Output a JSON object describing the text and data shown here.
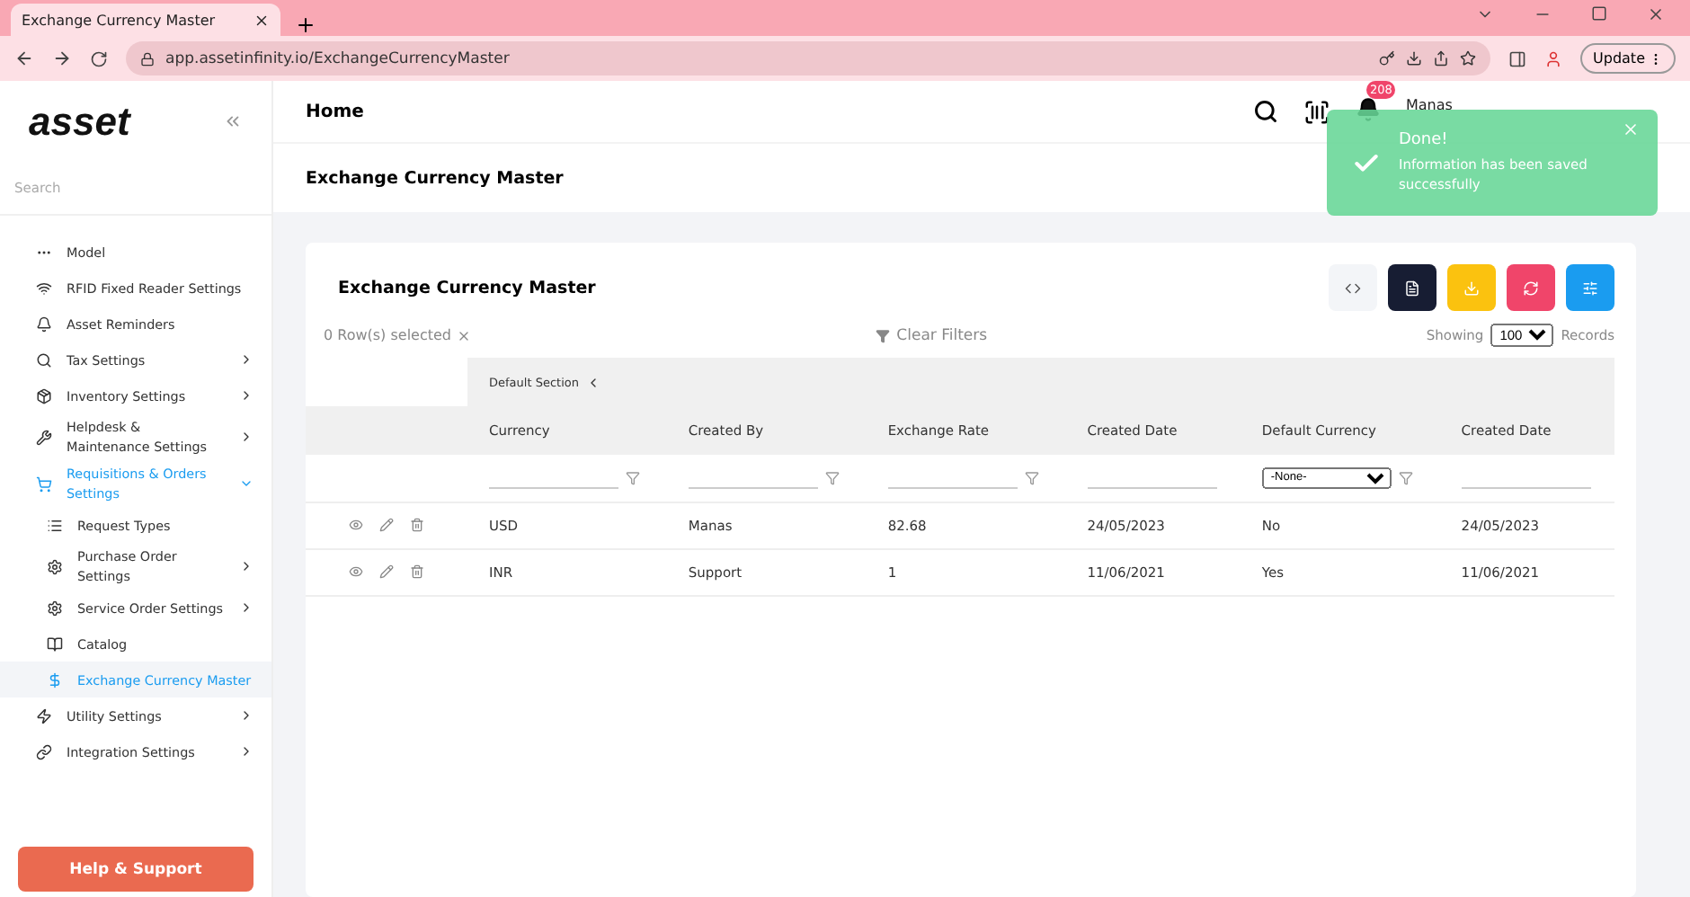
{
  "browser": {
    "tab_title": "Exchange Currency Master",
    "url": "app.assetinfinity.io/ExchangeCurrencyMaster",
    "update_label": "Update"
  },
  "sidebar": {
    "logo": "asset",
    "search_placeholder": "Search",
    "items": [
      {
        "label": "Model",
        "selected": false,
        "has_children": false
      },
      {
        "label": "RFID Fixed Reader Settings",
        "selected": false,
        "has_children": false
      },
      {
        "label": "Asset Reminders",
        "selected": false,
        "has_children": false
      },
      {
        "label": "Tax Settings",
        "selected": false,
        "has_children": true
      },
      {
        "label": "Inventory Settings",
        "selected": false,
        "has_children": true
      },
      {
        "label": "Helpdesk & Maintenance Settings",
        "selected": false,
        "has_children": true
      },
      {
        "label": "Requisitions & Orders Settings",
        "selected": true,
        "has_children": true,
        "expanded": true,
        "children": [
          {
            "label": "Request Types",
            "selected": false,
            "has_children": false
          },
          {
            "label": "Purchase Order Settings",
            "selected": false,
            "has_children": true
          },
          {
            "label": "Service Order Settings",
            "selected": false,
            "has_children": true
          },
          {
            "label": "Catalog",
            "selected": false,
            "has_children": false
          },
          {
            "label": "Exchange Currency Master",
            "selected": true,
            "has_children": false
          }
        ]
      },
      {
        "label": "Utility Settings",
        "selected": false,
        "has_children": true
      },
      {
        "label": "Integration Settings",
        "selected": false,
        "has_children": true
      }
    ],
    "help_button": "Help & Support"
  },
  "header": {
    "title": "Home",
    "notification_count": "208",
    "user_name": "Manas"
  },
  "page_title": "Exchange Currency Master",
  "toast": {
    "title": "Done!",
    "message": "Information has been saved successfully"
  },
  "card": {
    "title": "Exchange Currency Master",
    "rows_selected": "0 Row(s) selected",
    "clear_filters": "Clear Filters",
    "showing_label": "Showing",
    "page_size": "100",
    "records_label": "Records",
    "section": "Default Section",
    "columns": [
      "Currency",
      "Created By",
      "Exchange Rate",
      "Created Date",
      "Default Currency",
      "Created Date"
    ],
    "filters": [
      {
        "kind": "text"
      },
      {
        "kind": "text"
      },
      {
        "kind": "text"
      },
      {
        "kind": "date"
      },
      {
        "kind": "select",
        "value": "-None-"
      },
      {
        "kind": "date"
      }
    ],
    "rows": [
      [
        "USD",
        "Manas",
        "82.68",
        "24/05/2023",
        "No",
        "24/05/2023"
      ],
      [
        "INR",
        "Support",
        "1",
        "11/06/2021",
        "Yes",
        "11/06/2021"
      ]
    ]
  }
}
